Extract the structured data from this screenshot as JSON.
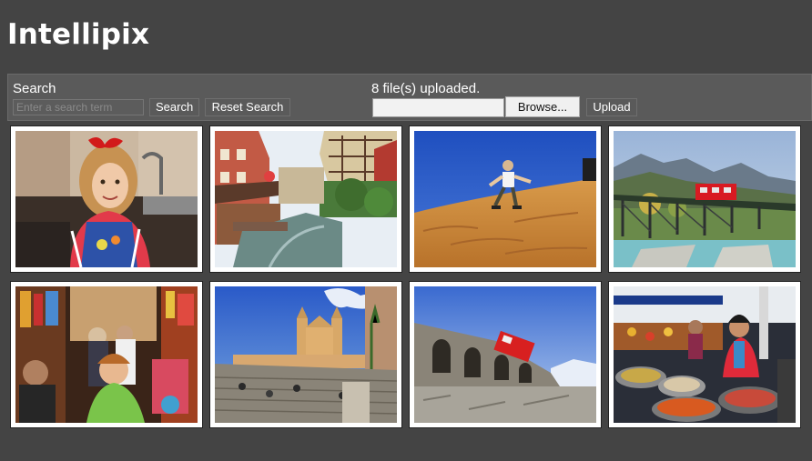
{
  "app": {
    "title": "Intellipix"
  },
  "search": {
    "label": "Search",
    "placeholder": "Enter a search term",
    "value": "",
    "search_button": "Search",
    "reset_button": "Reset Search"
  },
  "upload": {
    "status": "8 file(s) uploaded.",
    "file_path": "",
    "browse_button": "Browse...",
    "upload_button": "Upload"
  },
  "gallery": {
    "photos": [
      {
        "name": "girl-with-red-bow"
      },
      {
        "name": "canal-half-timbered-houses"
      },
      {
        "name": "person-sliding-sand-dune"
      },
      {
        "name": "red-train-on-bridge"
      },
      {
        "name": "market-street-crowd"
      },
      {
        "name": "church-and-steps"
      },
      {
        "name": "red-train-on-viaduct"
      },
      {
        "name": "street-food-vendor"
      }
    ]
  }
}
